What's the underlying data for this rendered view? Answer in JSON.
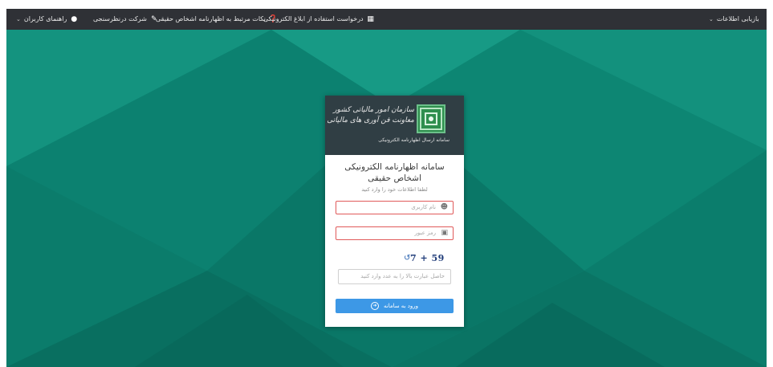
{
  "topbar": {
    "items_left": [
      {
        "label": "راهنمای کاربران",
        "icon": "chat-bubble-icon",
        "has_dropdown": true
      },
      {
        "label": "شرکت درنظرسنجی",
        "icon": "edit-icon",
        "has_dropdown": false
      },
      {
        "label": "نکات مرتبط به اظهارنامه اشخاص حقیقی",
        "icon": "question-circle-icon",
        "has_dropdown": false
      },
      {
        "label": "درخواست استفاده از ابلاغ الکترونیکی",
        "icon": "file-icon",
        "has_dropdown": false
      }
    ],
    "item_right": {
      "label": "بازیابی اطلاعات",
      "has_dropdown": true
    }
  },
  "card": {
    "header": {
      "org_line1": "سازمان امور مالیاتی کشور",
      "org_line2": "معاونت فن آوری های مالیاتی",
      "org_line3": "سامانه ارسال اظهارنامه الکترونیکی"
    },
    "title": "سامانه اظهارنامه الکترونیکی اشخاص حقیقی",
    "subtitle": "لطفا اطلاعات خود را وارد کنید",
    "username": {
      "placeholder": "نام کاربری",
      "value": ""
    },
    "password": {
      "placeholder": "رمز عبور",
      "value": ""
    },
    "captcha": {
      "expression": "7 + 59"
    },
    "captcha_answer": {
      "placeholder": "حاصل عبارت بالا را به عدد وارد کنید",
      "value": ""
    },
    "login_button": "ورود به سامانه"
  },
  "colors": {
    "topbar": "#2f3136",
    "background": "#0f8a78",
    "card_header": "#303e44",
    "button": "#3d98e6",
    "field_error_border": "#e05a5a"
  },
  "icons": {
    "user": "user-icon",
    "lock": "lock-icon",
    "refresh": "refresh-icon",
    "login": "arrow-circle-icon"
  }
}
